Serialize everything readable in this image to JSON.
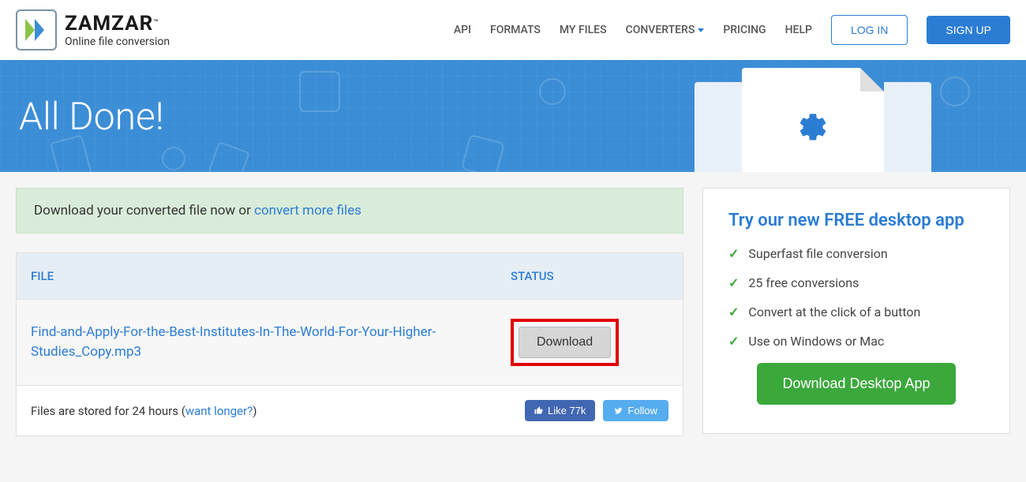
{
  "header": {
    "logo_title": "ZAMZAR",
    "logo_tm": "™",
    "logo_subtitle": "Online file conversion",
    "nav": {
      "api": "API",
      "formats": "FORMATS",
      "my_files": "MY FILES",
      "converters": "CONVERTERS",
      "pricing": "PRICING",
      "help": "HELP"
    },
    "login": "LOG IN",
    "signup": "SIGN UP"
  },
  "hero": {
    "title": "All Done!"
  },
  "success": {
    "prefix": "Download your converted file now or ",
    "link": "convert more files"
  },
  "table": {
    "col_file": "FILE",
    "col_status": "STATUS",
    "rows": [
      {
        "name": "Find-and-Apply-For-the-Best-Institutes-In-The-World-For-Your-Higher-Studies_Copy.mp3",
        "action": "Download"
      }
    ],
    "footer_prefix": "Files are stored for 24 hours (",
    "footer_link": "want longer?",
    "footer_suffix": ")",
    "fb_like": "Like 77k",
    "tw_follow": "Follow"
  },
  "sidebar": {
    "title": "Try our new FREE desktop app",
    "features": [
      "Superfast file conversion",
      "25 free conversions",
      "Convert at the click of a button",
      "Use on Windows or Mac"
    ],
    "cta": "Download Desktop App"
  }
}
